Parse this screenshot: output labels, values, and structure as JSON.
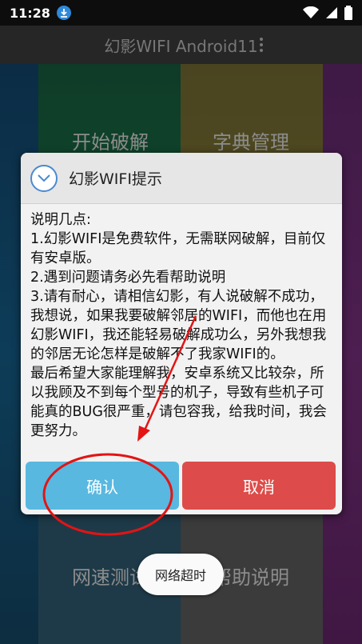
{
  "status_bar": {
    "time": "11:28",
    "icons": [
      "download-icon",
      "wifi-icon",
      "signal-icon",
      "battery-icon"
    ]
  },
  "app_bar": {
    "title": "幻影WIFI Android11"
  },
  "tiles": {
    "start_crack": "开始破解",
    "dictionary": "字典管理",
    "speed_test": "网速测试",
    "help": "帮助说明"
  },
  "dialog": {
    "title": "幻影WIFI提示",
    "lines": [
      "说明几点:",
      "1.幻影WIFI是免费软件，无需联网破解，目前仅有安卓版。",
      "2.遇到问题请务必先看帮助说明",
      "3.请有耐心，请相信幻影，有人说破解不成功，我想说，如果我要破解邻居的WIFI，而他也在用幻影WIFI，我还能轻易破解成功么，另外我想我的邻居无论怎样是破解不了我家WIFI的。",
      "最后希望大家能理解我，安卓系统又比较杂，所以我顾及不到每个型号的机子，导致有些机子可能真的BUG很严重，请包容我，给我时间，我会更努力。"
    ],
    "ok_label": "确认",
    "cancel_label": "取消"
  },
  "toast": "网络超时",
  "colors": {
    "ok": "#58b8e0",
    "cancel": "#dd4c4a",
    "annotation": "#e31414"
  }
}
